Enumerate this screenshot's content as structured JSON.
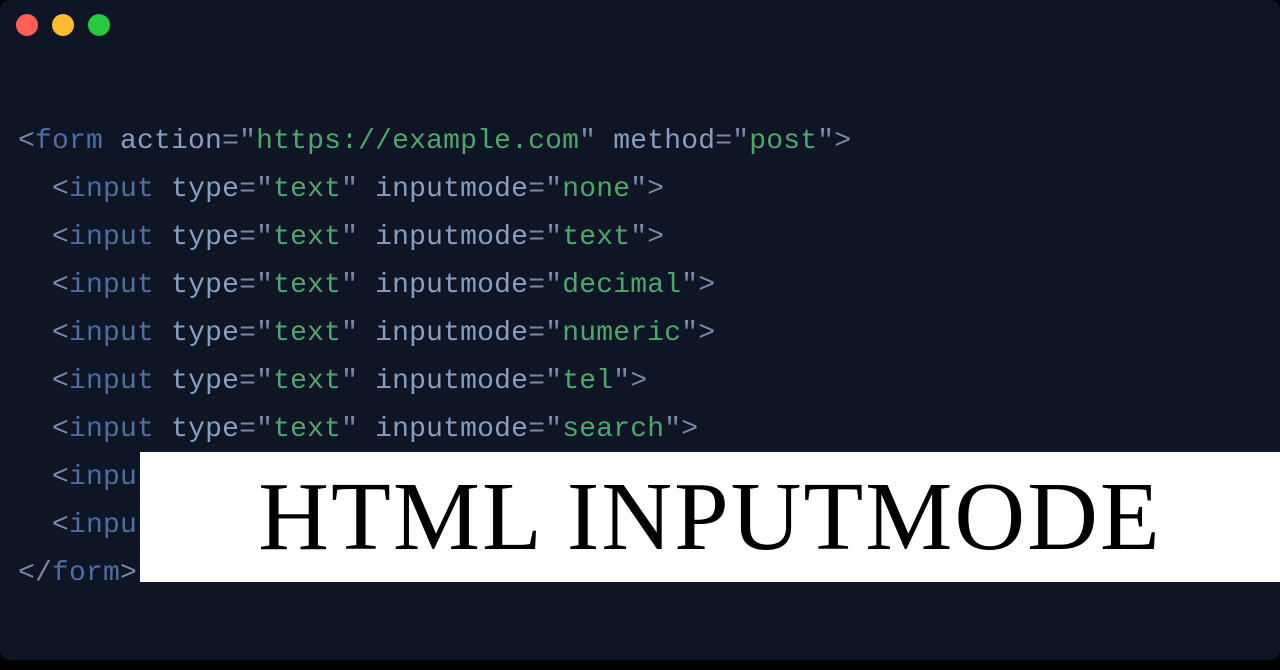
{
  "colors": {
    "background": "#0e1525",
    "punctuation": "#7b89a8",
    "tag": "#4f6da3",
    "attribute": "#889ec0",
    "string": "#4fa66b",
    "dot_red": "#ff5f57",
    "dot_yellow": "#febc2e",
    "dot_green": "#28c840"
  },
  "overlay_text": "HTML INPUTMODE",
  "code": {
    "form_open": {
      "lt": "<",
      "tag": "form",
      "sp1": " ",
      "attr1": "action",
      "eq1": "=",
      "q1a": "\"",
      "val1": "https://example.com",
      "q1b": "\"",
      "sp2": " ",
      "attr2": "method",
      "eq2": "=",
      "q2a": "\"",
      "val2": "post",
      "q2b": "\"",
      "gt": ">"
    },
    "inputs": [
      {
        "indent": "  ",
        "lt": "<",
        "tag": "input",
        "sp1": " ",
        "attr1": "type",
        "eq1": "=",
        "q1a": "\"",
        "val1": "text",
        "q1b": "\"",
        "sp2": " ",
        "attr2": "inputmode",
        "eq2": "=",
        "q2a": "\"",
        "val2": "none",
        "q2b": "\"",
        "gt": ">"
      },
      {
        "indent": "  ",
        "lt": "<",
        "tag": "input",
        "sp1": " ",
        "attr1": "type",
        "eq1": "=",
        "q1a": "\"",
        "val1": "text",
        "q1b": "\"",
        "sp2": " ",
        "attr2": "inputmode",
        "eq2": "=",
        "q2a": "\"",
        "val2": "text",
        "q2b": "\"",
        "gt": ">"
      },
      {
        "indent": "  ",
        "lt": "<",
        "tag": "input",
        "sp1": " ",
        "attr1": "type",
        "eq1": "=",
        "q1a": "\"",
        "val1": "text",
        "q1b": "\"",
        "sp2": " ",
        "attr2": "inputmode",
        "eq2": "=",
        "q2a": "\"",
        "val2": "decimal",
        "q2b": "\"",
        "gt": ">"
      },
      {
        "indent": "  ",
        "lt": "<",
        "tag": "input",
        "sp1": " ",
        "attr1": "type",
        "eq1": "=",
        "q1a": "\"",
        "val1": "text",
        "q1b": "\"",
        "sp2": " ",
        "attr2": "inputmode",
        "eq2": "=",
        "q2a": "\"",
        "val2": "numeric",
        "q2b": "\"",
        "gt": ">"
      },
      {
        "indent": "  ",
        "lt": "<",
        "tag": "input",
        "sp1": " ",
        "attr1": "type",
        "eq1": "=",
        "q1a": "\"",
        "val1": "text",
        "q1b": "\"",
        "sp2": " ",
        "attr2": "inputmode",
        "eq2": "=",
        "q2a": "\"",
        "val2": "tel",
        "q2b": "\"",
        "gt": ">"
      },
      {
        "indent": "  ",
        "lt": "<",
        "tag": "input",
        "sp1": " ",
        "attr1": "type",
        "eq1": "=",
        "q1a": "\"",
        "val1": "text",
        "q1b": "\"",
        "sp2": " ",
        "attr2": "inputmode",
        "eq2": "=",
        "q2a": "\"",
        "val2": "search",
        "q2b": "\"",
        "gt": ">"
      }
    ],
    "partial_inputs": [
      {
        "indent": "  ",
        "lt": "<",
        "tag_fragment": "inpu"
      },
      {
        "indent": "  ",
        "lt": "<",
        "tag_fragment": "inpu"
      }
    ],
    "form_close": {
      "lt": "</",
      "tag": "form",
      "gt": ">"
    }
  }
}
